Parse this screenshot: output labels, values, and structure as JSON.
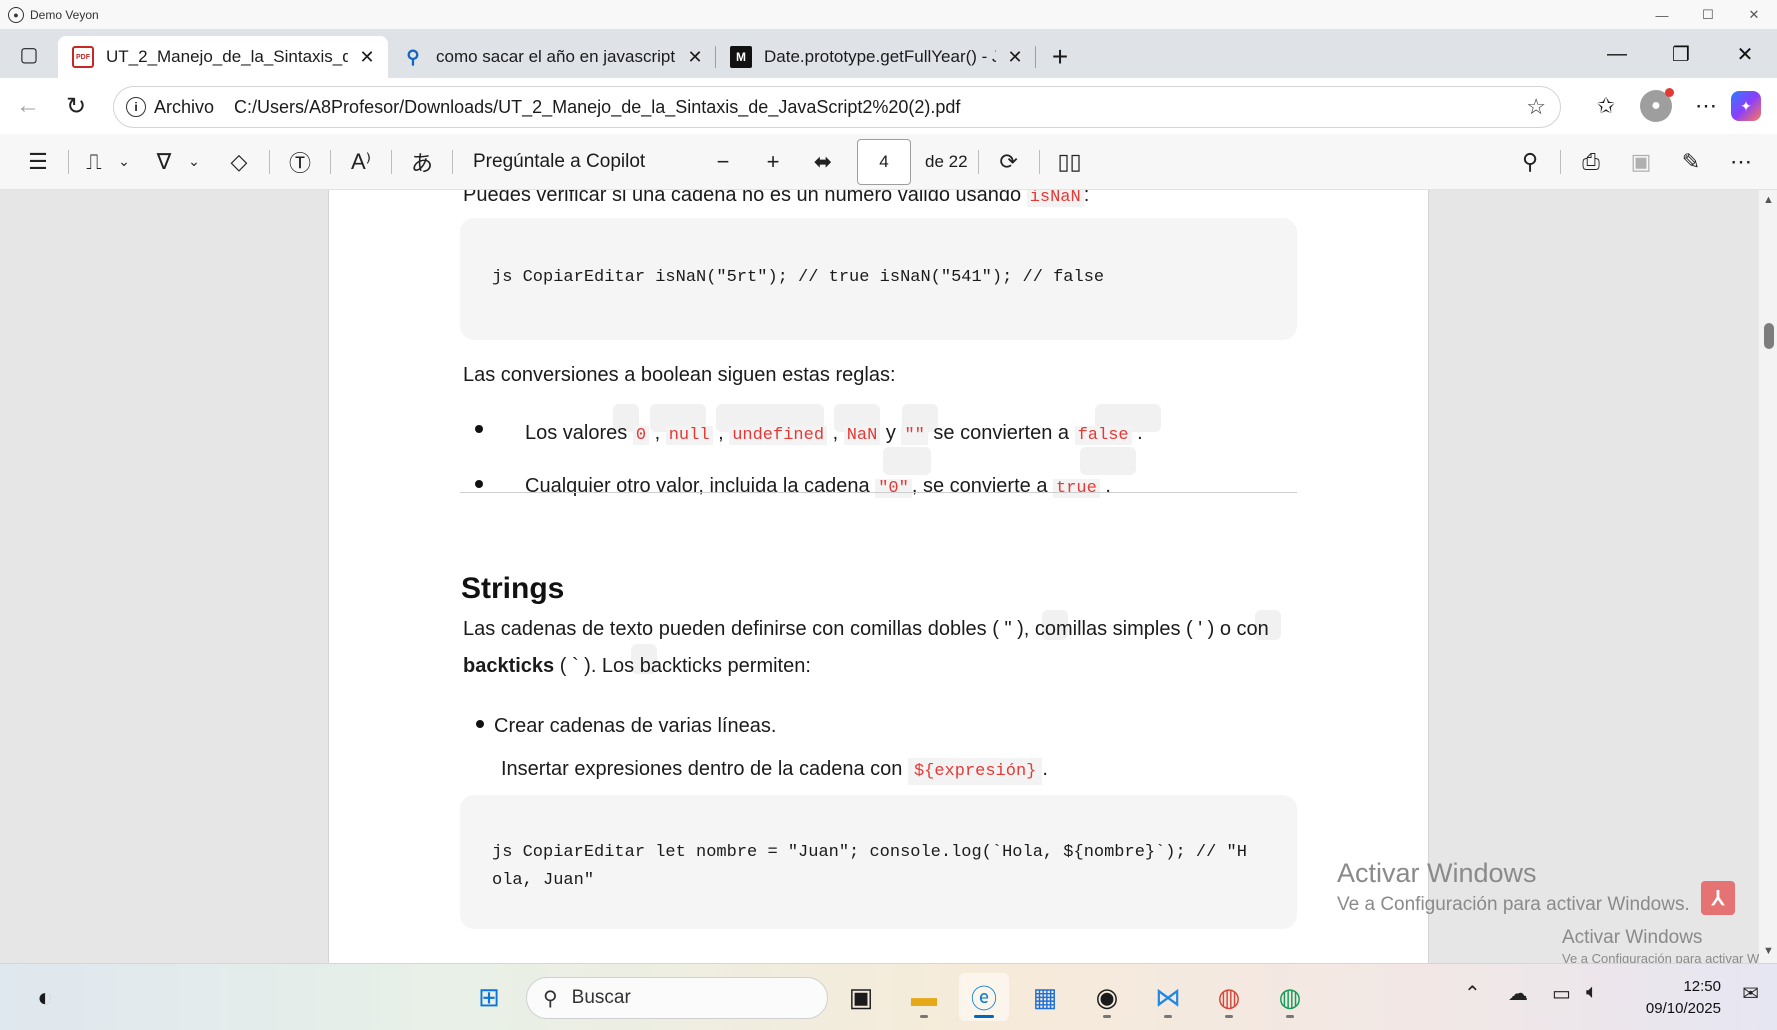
{
  "veyon": {
    "title": "Demo Veyon"
  },
  "tabs": [
    {
      "title": "UT_2_Manejo_de_la_Sintaxis_de_Ja",
      "icon": "pdf-icon"
    },
    {
      "title": "como sacar el año en javascript - ",
      "icon": "search-icon"
    },
    {
      "title": "Date.prototype.getFullYear() - Java",
      "icon": "mdn-icon"
    }
  ],
  "address": {
    "security_label": "Archivo",
    "url": "C:/Users/A8Profesor/Downloads/UT_2_Manejo_de_la_Sintaxis_de_JavaScript2%20(2).pdf"
  },
  "pdf_toolbar": {
    "copilot_label": "Pregúntale a Copilot",
    "page_current": "4",
    "page_total": "de 22"
  },
  "doc": {
    "intro_line": "Puedes verificar si una cadena no es un número válido usando ",
    "intro_code": "isNaN",
    "intro_end": ":",
    "code1": "js CopiarEditar isNaN(\"5rt\"); // true isNaN(\"541\"); // false",
    "bool_title": "Las conversiones a boolean siguen estas reglas:",
    "b1_prefix": "Los valores ",
    "b1_c0": "0",
    "b1_c1": "null",
    "b1_c2": "undefined",
    "b1_c3": "NaN",
    "b1_y": " y ",
    "b1_c4": "\"\"",
    "b1_mid": " se convierten a ",
    "b1_c5": "false",
    "b2_prefix": "Cualquier otro valor, incluida la cadena ",
    "b2_c0": "\"0\"",
    "b2_mid": ", se convierte a ",
    "b2_c1": "true",
    "strings_heading": "Strings",
    "strings_p1": "Las cadenas de texto pueden definirse con comillas dobles ( \" ), comillas simples ( ' ) o con",
    "strings_p2_bold": "backticks",
    "strings_p2_rest": " ( ` ). Los backticks permiten:",
    "li1": "Crear cadenas de varias líneas.",
    "li2_prefix": "Insertar expresiones dentro de la cadena con ",
    "li2_code": "${expresión}",
    "code2_l1": "js CopiarEditar let nombre = \"Juan\"; console.log(`Hola, ${nombre}`); // \"H",
    "code2_l2": "ola, Juan\""
  },
  "watermark": {
    "title": "Activar Windows",
    "subtitle": "Ve a Configuración para activar Windows.",
    "title_small": "Activar Windows",
    "subtitle_small": "Ve a Configuración para activar W"
  },
  "taskbar": {
    "search_placeholder": "Buscar",
    "time": "12:50",
    "date": "09/10/2025"
  }
}
